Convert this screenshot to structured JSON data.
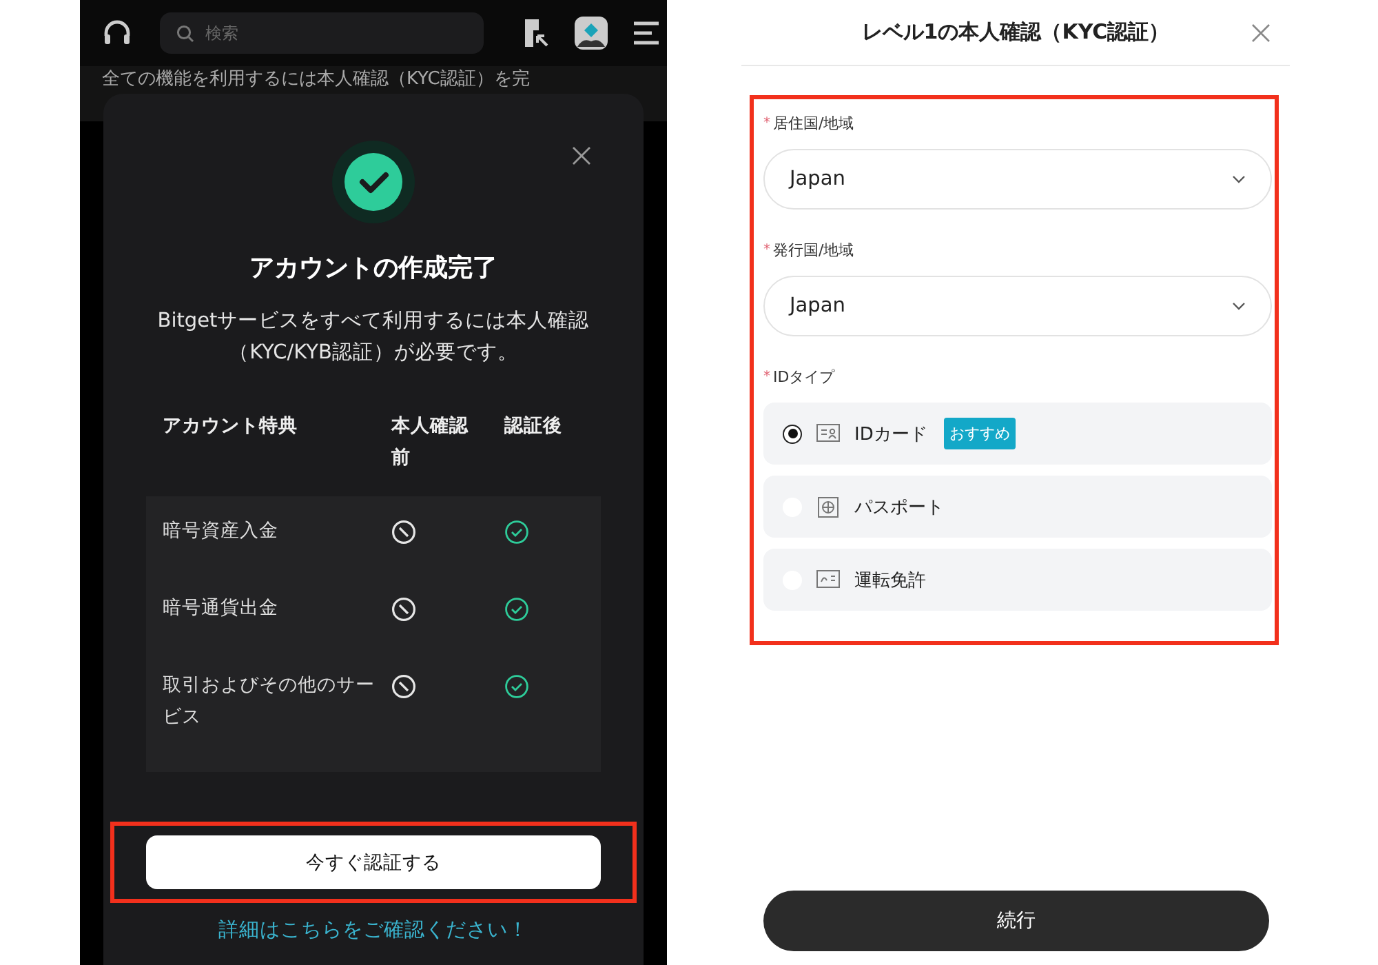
{
  "phone_left": {
    "header": {
      "search": {
        "placeholder": "検索"
      }
    },
    "banner": "全ての機能を利用するには本人確認（KYC認証）を完",
    "modal": {
      "title": "アカウントの作成完了",
      "description": "Bitgetサービスをすべて利用するには本人確認（KYC/KYB認証）が必要です。",
      "table": {
        "columns": [
          "アカウント特典",
          "本人確認前",
          "認証後"
        ],
        "rows": [
          {
            "feature": "暗号資産入金",
            "before": false,
            "after": true
          },
          {
            "feature": "暗号通貨出金",
            "before": false,
            "after": true
          },
          {
            "feature": "取引およびその他のサービス",
            "before": false,
            "after": true
          }
        ]
      },
      "primary_button": {
        "label": "今すぐ認証する",
        "highlighted": true
      },
      "link": "詳細はこちらをご確認ください！"
    }
  },
  "kyc_form": {
    "title": "レベル1の本人確認（KYC認証）",
    "highlighted": true,
    "fields": [
      {
        "label": "居住国/地域",
        "required_mark": "*",
        "value": "Japan"
      },
      {
        "label": "発行国/地域",
        "required_mark": "*",
        "value": "Japan"
      }
    ],
    "id_type": {
      "label": "IDタイプ",
      "required_mark": "*",
      "options": [
        {
          "kind": "id-card",
          "label": "IDカード",
          "badge": "おすすめ",
          "selected": true
        },
        {
          "kind": "passport",
          "label": "パスポート",
          "selected": false
        },
        {
          "kind": "license",
          "label": "運転免許",
          "selected": false
        }
      ]
    },
    "continue_button": "続行"
  }
}
